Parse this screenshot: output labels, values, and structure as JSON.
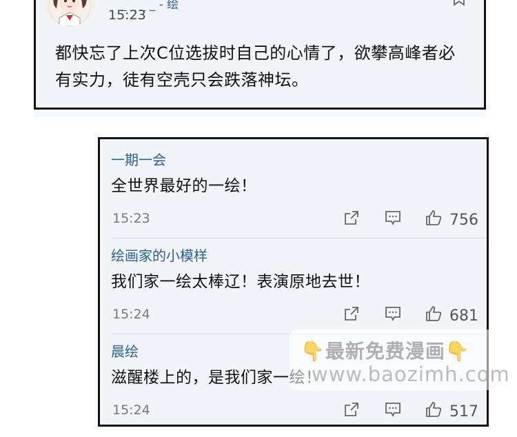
{
  "top_post": {
    "name": "_ _ _ _ - 绘",
    "time": "15:23",
    "text": "都快忘了上次C位选拔时自己的心情了，欲攀高峰者必有实力，徒有空壳只会跌落神坛。"
  },
  "comments": [
    {
      "name": "一期一会",
      "text": "全世界最好的一绘！",
      "time": "15:23",
      "likes": "756"
    },
    {
      "name": "绘画家的小模样",
      "text": "我们家一绘太棒辽！表演原地去世！",
      "time": "15:24",
      "likes": "681"
    },
    {
      "name": "晨绘",
      "text": "滋醒楼上的，是我们家一绘！",
      "time": "15:24",
      "likes": "517"
    }
  ],
  "icons": {
    "share": "share-icon",
    "reply": "comment-icon",
    "like": "thumbs-up-icon",
    "bookmark": "bookmark-icon"
  },
  "watermark": {
    "line1": "👇最新免费漫画👇",
    "line2": "www.baozimh.com"
  },
  "colors": {
    "name_blue": "#2d5f93",
    "panel_bg": "#f1f5fa"
  }
}
